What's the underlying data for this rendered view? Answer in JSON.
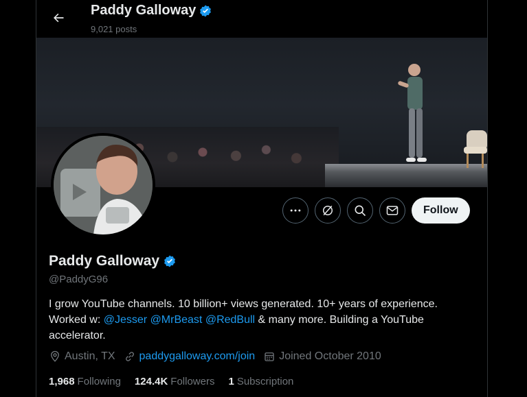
{
  "header": {
    "name": "Paddy Galloway",
    "posts_count": "9,021 posts"
  },
  "profile": {
    "name": "Paddy Galloway",
    "handle": "@PaddyG96",
    "bio": {
      "line1": "I grow YouTube channels. 10 billion+ views generated. 10+ years of experience.",
      "worked_prefix": "Worked w: ",
      "mention1": "@Jesser",
      "mention2": "@MrBeast",
      "mention3": "@RedBull",
      "suffix": " & many more. Building a YouTube accelerator."
    },
    "location": "Austin, TX",
    "website": "paddygalloway.com/join",
    "joined": "Joined October 2010"
  },
  "actions": {
    "follow_label": "Follow"
  },
  "stats": {
    "following_count": "1,968",
    "following_label": "Following",
    "followers_count": "124.4K",
    "followers_label": "Followers",
    "subscription_count": "1",
    "subscription_label": "Subscription"
  },
  "colors": {
    "accent": "#1d9bf0",
    "background": "#000000",
    "secondary_text": "#71767b",
    "border": "#536471"
  },
  "icons": [
    "back-arrow-icon",
    "verified-badge-icon",
    "more-icon",
    "grok-icon",
    "search-icon",
    "message-icon",
    "location-icon",
    "link-icon",
    "calendar-icon"
  ]
}
